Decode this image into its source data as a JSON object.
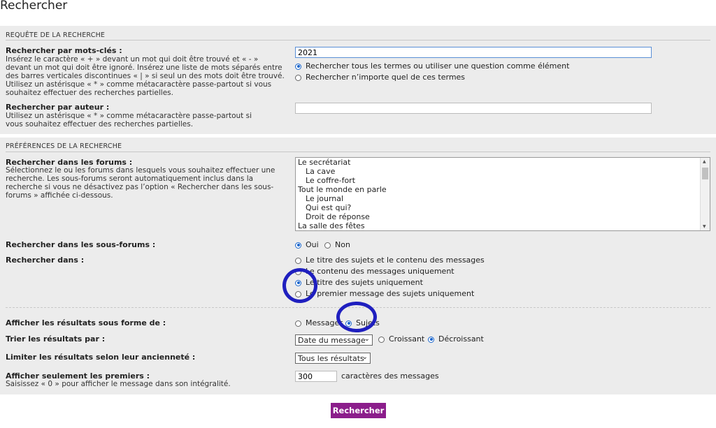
{
  "page_title": "Rechercher",
  "query": {
    "heading": "REQUÊTE DE LA RECHERCHE",
    "keywords": {
      "label": "Rechercher par mots-clés :",
      "desc": "Insérez le caractère « + » devant un mot qui doit être trouvé et « - » devant un mot qui doit être ignoré. Insérez une liste de mots séparés entre des barres verticales discontinues « | » si seul un des mots doit être trouvé. Utilisez un astérisque « * » comme métacaractère passe-partout si vous souhaitez effectuer des recherches partielles.",
      "value": "2021",
      "opt_all": "Rechercher tous les termes ou utiliser une question comme élément",
      "opt_any": "Rechercher n’importe quel de ces termes"
    },
    "author": {
      "label": "Rechercher par auteur :",
      "desc": "Utilisez un astérisque « * » comme métacaractère passe-partout si vous souhaitez effectuer des recherches partielles.",
      "value": ""
    }
  },
  "prefs": {
    "heading": "PRÉFÉRENCES DE LA RECHERCHE",
    "forums": {
      "label": "Rechercher dans les forums :",
      "desc": "Sélectionnez le ou les forums dans lesquels vous souhaitez effectuer une recherche. Les sous-forums seront automatiquement inclus dans la recherche si vous ne désactivez pas l’option « Rechercher dans les sous-forums » affichée ci-dessous.",
      "items": [
        "Le secrétariat",
        "La cave",
        "Le coffre-fort",
        "Tout le monde en parle",
        "Le journal",
        "Qui est qui?",
        "Droit de réponse",
        "La salle des fêtes"
      ]
    },
    "subforums": {
      "label": "Rechercher dans les sous-forums :",
      "yes": "Oui",
      "no": "Non"
    },
    "search_in": {
      "label": "Rechercher dans :",
      "opt1": "Le titre des sujets et le contenu des messages",
      "opt2": "Le contenu des messages uniquement",
      "opt3": "Le titre des sujets uniquement",
      "opt4": "Le premier message des sujets uniquement"
    },
    "display": {
      "label": "Afficher les résultats sous forme de :",
      "messages": "Messages",
      "topics": "Sujets"
    },
    "sort": {
      "label": "Trier les résultats par :",
      "field": "Date du message",
      "asc": "Croissant",
      "desc": "Décroissant"
    },
    "limit": {
      "label": "Limiter les résultats selon leur ancienneté :",
      "value": "Tous les résultats"
    },
    "first": {
      "label": "Afficher seulement les premiers :",
      "desc": "Saisissez « 0 » pour afficher le message dans son intégralité.",
      "value": "300",
      "suffix": "caractères des messages"
    }
  },
  "submit_label": "Rechercher",
  "colors": {
    "button": "#8b1d8b",
    "annotation": "#1f1fbf",
    "radio_checked": "#1a66cc"
  }
}
